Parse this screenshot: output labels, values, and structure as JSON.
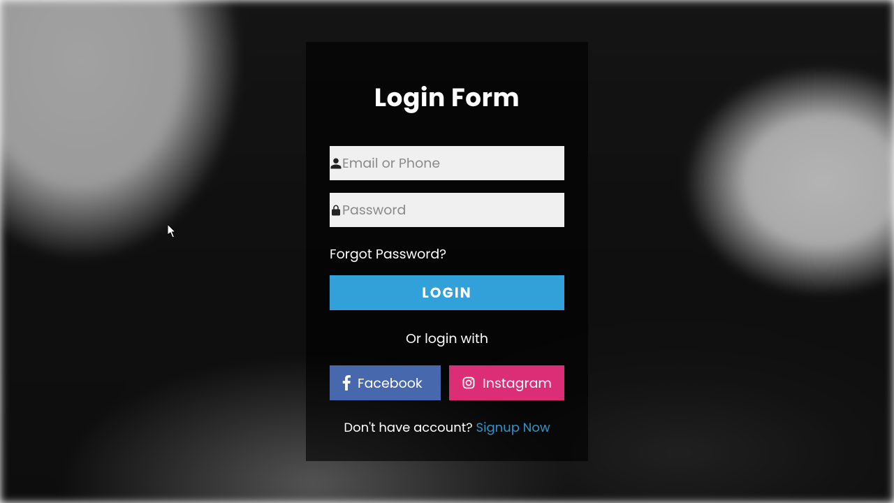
{
  "title": "Login Form",
  "fields": {
    "email_placeholder": "Email or Phone",
    "password_placeholder": "Password"
  },
  "forgot_label": "Forgot Password?",
  "login_button": "LOGIN",
  "or_login_with": "Or login with",
  "social": {
    "facebook_label": "Facebook",
    "instagram_label": "Instagram"
  },
  "signup_prompt": "Don't have account? ",
  "signup_link": "Signup Now",
  "colors": {
    "login_btn": "#33a1d9",
    "facebook": "#4868ad",
    "instagram": "#dc2d77",
    "link": "#2f93c6"
  }
}
